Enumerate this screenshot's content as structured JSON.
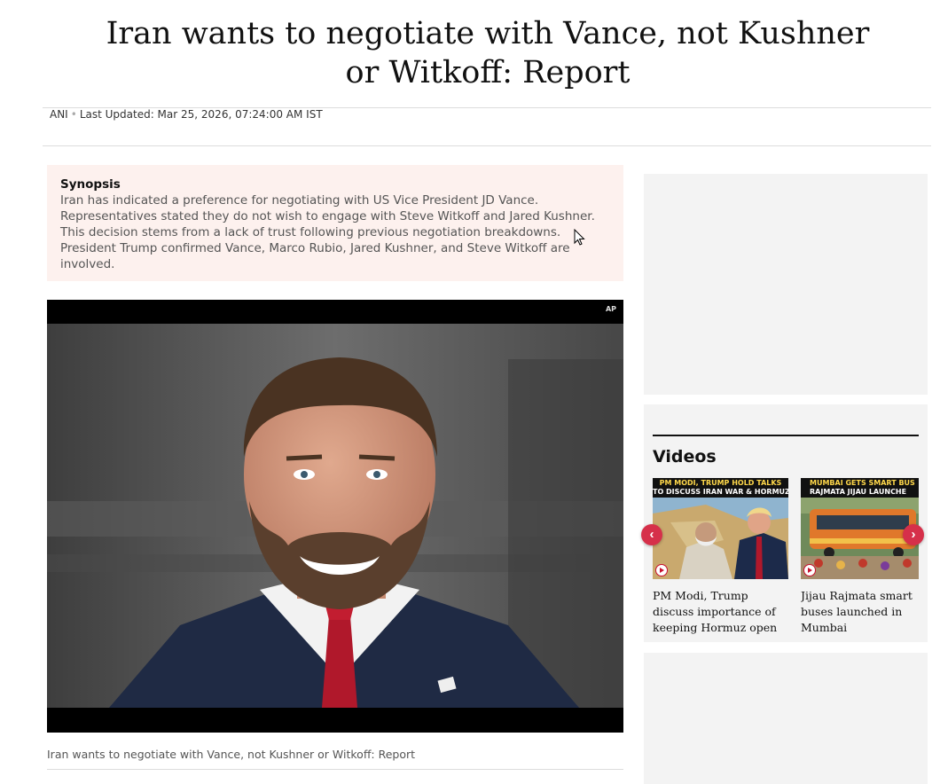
{
  "article": {
    "headline": "Iran wants to negotiate with Vance, not Kushner or Witkoff: Report",
    "source": "ANI",
    "separator": "•",
    "last_updated": "Last Updated: Mar 25, 2026, 07:24:00 AM IST",
    "synopsis_title": "Synopsis",
    "synopsis_body": "Iran has indicated a preference for negotiating with US Vice President JD Vance. Representatives stated they do not wish to engage with Steve Witkoff and Jared Kushner. This decision stems from a lack of trust following previous negotiation breakdowns. President Trump confirmed Vance, Marco Rubio, Jared Kushner, and Steve Witkoff are involved.",
    "image_credit": "AP",
    "image_caption": "Iran wants to negotiate with Vance, not Kushner or Witkoff: Report"
  },
  "sidebar": {
    "videos_title": "Videos",
    "prev_icon": "chevron-left-icon",
    "next_icon": "chevron-right-icon",
    "videos": [
      {
        "thumb_line1": "PM MODI, TRUMP HOLD TALKS",
        "thumb_line2": "TO DISCUSS IRAN WAR & HORMUZ",
        "title": "PM Modi, Trump discuss importance of keeping Hormuz open"
      },
      {
        "thumb_line1": "MUMBAI GETS SMART BUS",
        "thumb_line2": "RAJMATA JIJAU LAUNCHE",
        "title": "Jijau Rajmata smart buses launched in Mumbai"
      }
    ]
  },
  "colors": {
    "synopsis_bg": "#fdf1ee",
    "accent": "#d6304a",
    "ad_placeholder": "#f3f3f3"
  }
}
